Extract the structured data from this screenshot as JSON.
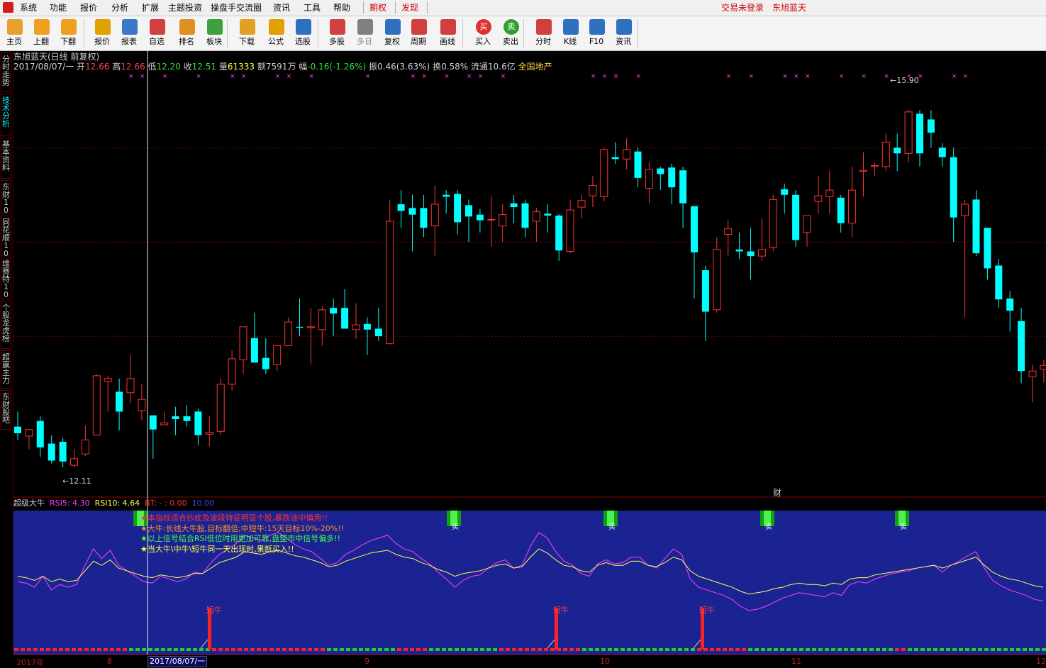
{
  "menu": {
    "items": [
      "系统",
      "功能",
      "报价",
      "分析",
      "扩展",
      "主题投资",
      "操盘手交流圈",
      "资讯",
      "工具",
      "帮助"
    ],
    "highlight_items": [
      "期权",
      "发现"
    ],
    "status_login": "交易未登录",
    "status_account": "东旭蓝天"
  },
  "toolbar": {
    "buttons": [
      {
        "label": "主页",
        "icon": "home-icon",
        "color": "#e8a030"
      },
      {
        "label": "上翻",
        "icon": "arrow-up-icon",
        "color": "#f0a020"
      },
      {
        "label": "下翻",
        "icon": "arrow-down-icon",
        "color": "#f0a020"
      },
      {
        "label": "报价",
        "icon": "quote-icon",
        "color": "#e0a000"
      },
      {
        "label": "报表",
        "icon": "report-icon",
        "color": "#3a78c8"
      },
      {
        "label": "自选",
        "icon": "f6-icon",
        "color": "#d04040"
      },
      {
        "label": "排名",
        "icon": "rank-icon",
        "color": "#e09020"
      },
      {
        "label": "板块",
        "icon": "sector-icon",
        "color": "#40a040"
      },
      {
        "label": "下载",
        "icon": "download-icon",
        "color": "#e0a020"
      },
      {
        "label": "公式",
        "icon": "formula-icon",
        "color": "#e0a000"
      },
      {
        "label": "选股",
        "icon": "pick-stock-icon",
        "color": "#3070c0"
      },
      {
        "label": "多股",
        "icon": "multi-stock-icon",
        "color": "#d04040"
      },
      {
        "label": "多日",
        "icon": "multi-day-icon",
        "color": "#808080",
        "disabled": true
      },
      {
        "label": "复权",
        "icon": "adjust-icon",
        "color": "#3070c0"
      },
      {
        "label": "周期",
        "icon": "f8-icon",
        "color": "#d04040"
      },
      {
        "label": "画线",
        "icon": "draw-line-icon",
        "color": "#d04040"
      },
      {
        "label": "买入",
        "icon": "buy-icon",
        "color": "#e03030",
        "glyph": "买"
      },
      {
        "label": "卖出",
        "icon": "sell-icon",
        "color": "#30a030",
        "glyph": "卖"
      },
      {
        "label": "分时",
        "icon": "intraday-icon",
        "color": "#d04040"
      },
      {
        "label": "K线",
        "icon": "kline-icon",
        "color": "#3070c0"
      },
      {
        "label": "F10",
        "icon": "f10-icon",
        "color": "#3070c0"
      },
      {
        "label": "资讯",
        "icon": "news-icon",
        "color": "#3070c0"
      }
    ]
  },
  "sidebar": {
    "tabs": [
      {
        "label": "分时走势",
        "active": false
      },
      {
        "label": "技术分析",
        "active": true
      },
      {
        "label": "基本资料",
        "active": false
      },
      {
        "label": "东财10",
        "active": false
      },
      {
        "label": "同花顺10",
        "active": false
      },
      {
        "label": "维赛特10",
        "active": false
      },
      {
        "label": "个股龙虎榜",
        "active": false
      },
      {
        "label": "超赢主力",
        "active": false
      },
      {
        "label": "东财股吧",
        "active": false
      }
    ]
  },
  "chart_header": {
    "title": "东旭蓝天(日线 前复权)",
    "date": "2017/08/07/一",
    "open_label": "开",
    "open": "12.66",
    "high_label": "高",
    "high": "12.66",
    "low_label": "低",
    "low": "12.20",
    "close_label": "收",
    "close": "12.51",
    "volume_label": "量",
    "volume": "61333",
    "amount_label": "额",
    "amount": "7591万",
    "change_label": "幅",
    "change": "-0.16(-1.26%)",
    "amplitude_label": "振",
    "amplitude": "0.46(3.63%)",
    "turnover_label": "换",
    "turnover": "0.58%",
    "float_label": "流通",
    "float": "10.6亿",
    "region": "全国地产"
  },
  "annotations": {
    "max_label": "15.90",
    "min_label": "12.11",
    "finance_marker": "财"
  },
  "indicator": {
    "name": "超级大牛",
    "rsi5_label": "RSI5:",
    "rsi5": "4.30",
    "rsi10_label": "RSI10:",
    "rsi10": "4.64",
    "bt_label": "BT:",
    "bt": "0.00",
    "extra": "10.00",
    "notes": [
      {
        "star": "#ff3030",
        "text": "本指标适合抄底及波段特征明显个股,暴跌途中慎用!!",
        "color": "#ff3030"
      },
      {
        "star": "#ff9020",
        "text": "大牛:长线大牛股,目标翻倍;中短牛:15天目标10%-20%!!",
        "color": "#ff9020"
      },
      {
        "star": "#40ff40",
        "text": "以上信号结合RSI低位时用更加可靠,盘整市中信号偏多!!",
        "color": "#40ff40"
      },
      {
        "star": "#ffff40",
        "text": "当大牛\\中牛\\短牛同一天出现时,果断买入!!",
        "color": "#ffff40"
      }
    ],
    "short_bull_label": "短牛",
    "sell_label": "卖"
  },
  "date_axis": {
    "labels": [
      "2017年",
      "8",
      "9",
      "10",
      "11",
      "12"
    ],
    "cursor_date": "2017/08/07/一"
  },
  "colors": {
    "up": "#ff3232",
    "down": "#00ffff",
    "indicator_bg": "#1b2392",
    "rsi5": "#ff40ff",
    "rsi10": "#ffff50",
    "grid": "#8b0000",
    "signal_red": "#ff2020",
    "signal_green": "#20d020"
  },
  "chart_data": {
    "type": "candlestick",
    "title": "东旭蓝天(日线 前复权)",
    "ylim": [
      11.8,
      16.3
    ],
    "hlines": [
      13.5,
      14.5,
      15.5
    ],
    "candles": [
      [
        12.54,
        12.7,
        12.4,
        12.47
      ],
      [
        12.44,
        12.5,
        12.3,
        12.51
      ],
      [
        12.6,
        12.65,
        12.22,
        12.32
      ],
      [
        12.36,
        12.45,
        12.15,
        12.18
      ],
      [
        12.38,
        12.42,
        12.11,
        12.17
      ],
      [
        12.13,
        12.3,
        12.11,
        12.2
      ],
      [
        12.25,
        12.55,
        12.23,
        12.4
      ],
      [
        12.45,
        13.1,
        12.45,
        13.08
      ],
      [
        13.02,
        13.08,
        12.7,
        13.05
      ],
      [
        12.91,
        13.05,
        12.5,
        12.7
      ],
      [
        12.9,
        13.3,
        12.79,
        13.05
      ],
      [
        12.71,
        12.99,
        12.61,
        12.83
      ],
      [
        12.66,
        12.66,
        12.2,
        12.51
      ],
      [
        12.56,
        12.7,
        12.56,
        12.58
      ],
      [
        12.65,
        12.75,
        12.45,
        12.62
      ],
      [
        12.65,
        12.77,
        12.54,
        12.6
      ],
      [
        12.7,
        12.73,
        12.34,
        12.45
      ],
      [
        12.46,
        12.65,
        12.33,
        12.48
      ],
      [
        12.49,
        13.05,
        12.45,
        12.99
      ],
      [
        12.99,
        13.35,
        12.92,
        13.26
      ],
      [
        13.25,
        13.6,
        13.1,
        13.6
      ],
      [
        13.48,
        13.75,
        13.26,
        13.22
      ],
      [
        13.27,
        13.48,
        13.1,
        13.15
      ],
      [
        13.2,
        13.4,
        13.13,
        13.4
      ],
      [
        13.4,
        13.7,
        13.4,
        13.65
      ],
      [
        13.6,
        13.9,
        13.5,
        13.59
      ],
      [
        13.59,
        13.8,
        13.2,
        13.6
      ],
      [
        13.57,
        13.82,
        13.4,
        13.78
      ],
      [
        13.8,
        13.9,
        13.5,
        13.74
      ],
      [
        13.8,
        14.0,
        13.66,
        13.58
      ],
      [
        13.57,
        13.85,
        13.47,
        13.62
      ],
      [
        13.63,
        13.7,
        13.3,
        13.57
      ],
      [
        13.58,
        13.8,
        13.45,
        13.5
      ],
      [
        13.42,
        14.95,
        13.42,
        14.72
      ],
      [
        14.9,
        15.05,
        14.65,
        14.83
      ],
      [
        14.86,
        15.0,
        14.4,
        14.79
      ],
      [
        14.86,
        15.0,
        14.55,
        14.65
      ],
      [
        14.67,
        15.1,
        14.35,
        14.9
      ],
      [
        15.0,
        15.05,
        14.8,
        14.98
      ],
      [
        15.01,
        15.05,
        14.58,
        14.71
      ],
      [
        14.89,
        14.95,
        14.5,
        14.77
      ],
      [
        14.79,
        14.85,
        14.6,
        14.73
      ],
      [
        14.74,
        14.98,
        14.45,
        14.74
      ],
      [
        14.67,
        14.9,
        14.5,
        14.79
      ],
      [
        14.91,
        15.0,
        14.7,
        14.87
      ],
      [
        14.91,
        14.95,
        14.55,
        14.65
      ],
      [
        14.72,
        14.86,
        14.5,
        14.82
      ],
      [
        14.8,
        14.9,
        14.6,
        14.78
      ],
      [
        14.78,
        14.8,
        14.3,
        14.41
      ],
      [
        14.4,
        14.95,
        14.38,
        14.84
      ],
      [
        14.87,
        15.0,
        14.75,
        14.94
      ],
      [
        14.99,
        15.2,
        14.87,
        15.1
      ],
      [
        14.98,
        15.5,
        14.93,
        15.48
      ],
      [
        15.4,
        15.56,
        15.33,
        15.38
      ],
      [
        15.38,
        15.6,
        15.27,
        15.48
      ],
      [
        15.46,
        15.5,
        15.08,
        15.18
      ],
      [
        15.07,
        15.35,
        14.91,
        15.27
      ],
      [
        15.28,
        15.3,
        15.05,
        15.22
      ],
      [
        15.29,
        15.33,
        14.9,
        15.08
      ],
      [
        15.26,
        15.3,
        14.65,
        14.91
      ],
      [
        14.88,
        14.88,
        13.9,
        14.39
      ],
      [
        14.2,
        14.25,
        13.45,
        13.76
      ],
      [
        13.78,
        14.55,
        13.75,
        14.42
      ],
      [
        14.58,
        14.73,
        14.35,
        14.64
      ],
      [
        14.42,
        14.6,
        14.32,
        14.4
      ],
      [
        14.4,
        14.65,
        14.1,
        14.35
      ],
      [
        14.35,
        14.75,
        14.3,
        14.42
      ],
      [
        14.44,
        15.0,
        14.4,
        14.95
      ],
      [
        15.06,
        15.12,
        14.8,
        15.0
      ],
      [
        15.0,
        15.05,
        14.45,
        14.52
      ],
      [
        14.6,
        14.75,
        14.45,
        14.78
      ],
      [
        14.93,
        15.2,
        14.8,
        14.99
      ],
      [
        14.98,
        15.25,
        14.8,
        15.05
      ],
      [
        14.97,
        15.0,
        14.6,
        14.7
      ],
      [
        14.7,
        15.3,
        14.55,
        15.05
      ],
      [
        15.25,
        15.45,
        14.98,
        15.26
      ],
      [
        15.3,
        15.34,
        15.2,
        15.31
      ],
      [
        15.3,
        15.65,
        15.25,
        15.56
      ],
      [
        15.5,
        15.65,
        15.25,
        15.44
      ],
      [
        15.44,
        15.9,
        15.35,
        15.88
      ],
      [
        15.86,
        15.9,
        15.3,
        15.44
      ],
      [
        15.8,
        15.9,
        15.5,
        15.66
      ],
      [
        15.5,
        15.55,
        15.3,
        15.4
      ],
      [
        15.4,
        15.5,
        14.5,
        14.76
      ],
      [
        14.78,
        14.95,
        13.7,
        14.9
      ],
      [
        14.95,
        15.05,
        14.35,
        14.38
      ],
      [
        14.65,
        14.65,
        14.1,
        14.22
      ],
      [
        14.25,
        14.32,
        13.8,
        13.89
      ],
      [
        13.9,
        13.98,
        13.55,
        13.77
      ],
      [
        13.66,
        13.8,
        13.0,
        13.13
      ],
      [
        13.07,
        13.2,
        12.8,
        13.13
      ],
      [
        13.15,
        13.25,
        13.01,
        13.19
      ],
      [
        13.18,
        13.55,
        13.05,
        13.33
      ],
      [
        13.15,
        13.25,
        12.95,
        13.02
      ]
    ],
    "rsi5": [
      48,
      47,
      44,
      52,
      42,
      46,
      44,
      46,
      60,
      72,
      65,
      71,
      60,
      56,
      52,
      48,
      47,
      52,
      50,
      48,
      50,
      55,
      54,
      62,
      68,
      72,
      76,
      82,
      80,
      78,
      82,
      84,
      80,
      75,
      72,
      70,
      65,
      60,
      62,
      68,
      71,
      75,
      78,
      80,
      82,
      76,
      72,
      70,
      65,
      61,
      55,
      50,
      44,
      49,
      52,
      53,
      58,
      62,
      64,
      58,
      60,
      74,
      84,
      80,
      70,
      63,
      60,
      54,
      52,
      61,
      64,
      61,
      62,
      66,
      66,
      60,
      58,
      65,
      72,
      68,
      50,
      44,
      42,
      40,
      38,
      35,
      30,
      27,
      28,
      30,
      33,
      36,
      38,
      40,
      39,
      38,
      37,
      40,
      38,
      46,
      48,
      47,
      50,
      52,
      54,
      55,
      56,
      58,
      59,
      60,
      55,
      60,
      63,
      67,
      70,
      58,
      49,
      45,
      42,
      40,
      38,
      35,
      34
    ],
    "rsi10": [
      52,
      51,
      49,
      52,
      48,
      50,
      48,
      49,
      56,
      63,
      60,
      64,
      58,
      56,
      54,
      52,
      51,
      53,
      52,
      51,
      52,
      54,
      54,
      58,
      62,
      64,
      66,
      70,
      69,
      68,
      70,
      71,
      69,
      67,
      66,
      64,
      62,
      59,
      60,
      63,
      65,
      67,
      69,
      70,
      71,
      68,
      66,
      65,
      62,
      60,
      57,
      55,
      52,
      54,
      55,
      56,
      58,
      60,
      61,
      58,
      59,
      66,
      72,
      69,
      64,
      60,
      59,
      56,
      55,
      60,
      62,
      60,
      60,
      63,
      63,
      60,
      59,
      62,
      66,
      64,
      56,
      52,
      50,
      48,
      46,
      44,
      41,
      39,
      40,
      41,
      43,
      44,
      46,
      47,
      46,
      46,
      45,
      47,
      46,
      50,
      51,
      51,
      53,
      54,
      55,
      56,
      57,
      58,
      59,
      60,
      58,
      60,
      62,
      64,
      66,
      60,
      55,
      52,
      50,
      49,
      47,
      45,
      44
    ],
    "short_bull_days": [
      17,
      48,
      61
    ],
    "sell_days": [
      38,
      52,
      66,
      78
    ]
  }
}
